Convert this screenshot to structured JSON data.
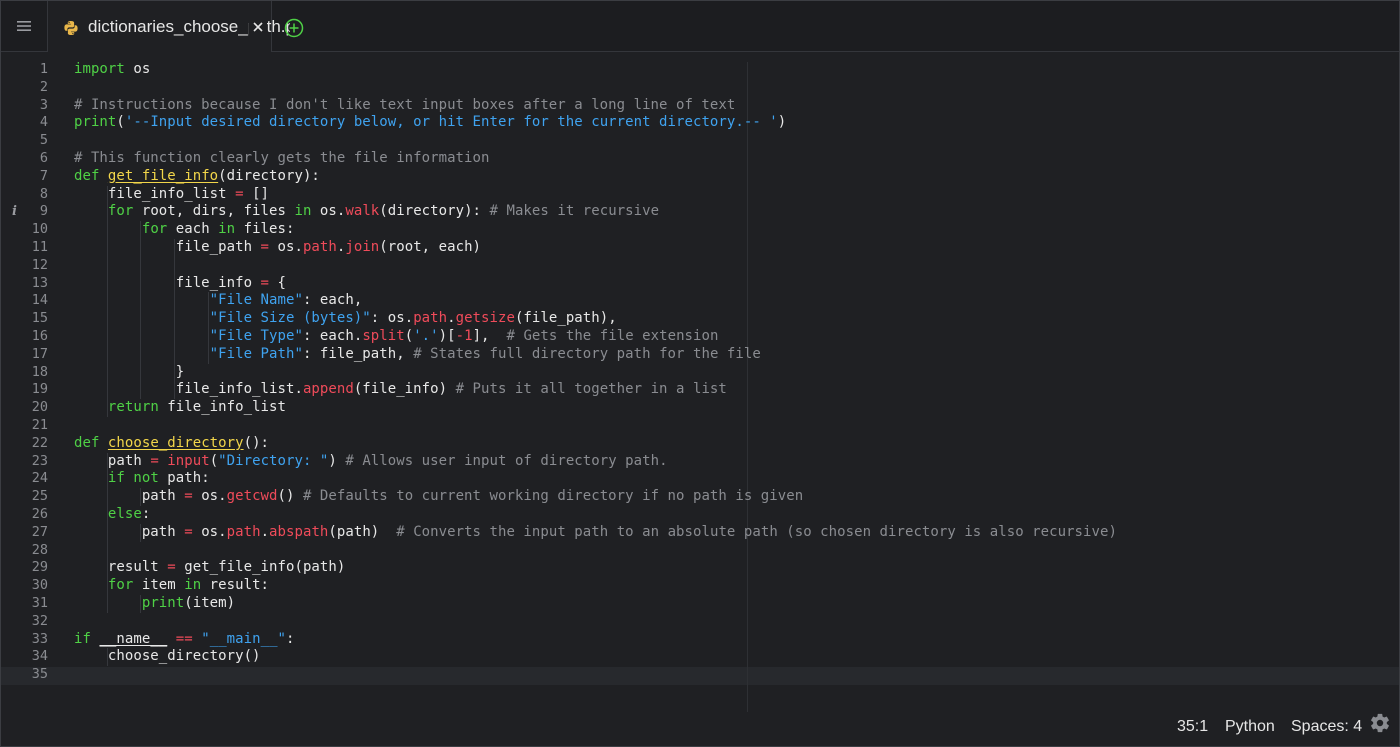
{
  "tab": {
    "title": "dictionaries_choose_path.py",
    "icon": "python-icon",
    "close_glyph": "×"
  },
  "editor": {
    "lines": [
      [
        [
          "kw",
          "import"
        ],
        [
          "t",
          " os"
        ]
      ],
      [],
      [
        [
          "cm",
          "# Instructions because I don't like text input boxes after a long line of text"
        ]
      ],
      [
        [
          "kw",
          "print"
        ],
        [
          "t",
          "("
        ],
        [
          "str",
          "'--Input desired directory below, or hit Enter for the current directory.-- '"
        ],
        [
          "t",
          ")"
        ]
      ],
      [],
      [
        [
          "cm",
          "# This function clearly gets the file information"
        ]
      ],
      [
        [
          "kw",
          "def"
        ],
        [
          "t",
          " "
        ],
        [
          "fn",
          "get_file_info"
        ],
        [
          "t",
          "(directory):"
        ]
      ],
      [
        [
          "t",
          "    file_info_list "
        ],
        [
          "op",
          "="
        ],
        [
          "t",
          " []"
        ]
      ],
      [
        [
          "t",
          "    "
        ],
        [
          "kw",
          "for"
        ],
        [
          "t",
          " root, dirs, files "
        ],
        [
          "kw",
          "in"
        ],
        [
          "t",
          " os."
        ],
        [
          "call",
          "walk"
        ],
        [
          "t",
          "(directory): "
        ],
        [
          "cm",
          "# Makes it recursive"
        ]
      ],
      [
        [
          "t",
          "        "
        ],
        [
          "kw",
          "for"
        ],
        [
          "t",
          " each "
        ],
        [
          "kw",
          "in"
        ],
        [
          "t",
          " files:"
        ]
      ],
      [
        [
          "t",
          "            file_path "
        ],
        [
          "op",
          "="
        ],
        [
          "t",
          " os."
        ],
        [
          "call",
          "path"
        ],
        [
          "t",
          "."
        ],
        [
          "call",
          "join"
        ],
        [
          "t",
          "(root, each)"
        ]
      ],
      [],
      [
        [
          "t",
          "            file_info "
        ],
        [
          "op",
          "="
        ],
        [
          "t",
          " {"
        ]
      ],
      [
        [
          "t",
          "                "
        ],
        [
          "str",
          "\"File Name\""
        ],
        [
          "t",
          ": each,"
        ]
      ],
      [
        [
          "t",
          "                "
        ],
        [
          "str",
          "\"File Size (bytes)\""
        ],
        [
          "t",
          ": os."
        ],
        [
          "call",
          "path"
        ],
        [
          "t",
          "."
        ],
        [
          "call",
          "getsize"
        ],
        [
          "t",
          "(file_path),"
        ]
      ],
      [
        [
          "t",
          "                "
        ],
        [
          "str",
          "\"File Type\""
        ],
        [
          "t",
          ": each."
        ],
        [
          "call",
          "split"
        ],
        [
          "t",
          "("
        ],
        [
          "str",
          "'.'"
        ],
        [
          "t",
          ")["
        ],
        [
          "num",
          "-1"
        ],
        [
          "t",
          "],  "
        ],
        [
          "cm",
          "# Gets the file extension"
        ]
      ],
      [
        [
          "t",
          "                "
        ],
        [
          "str",
          "\"File Path\""
        ],
        [
          "t",
          ": file_path, "
        ],
        [
          "cm",
          "# States full directory path for the file"
        ]
      ],
      [
        [
          "t",
          "            }"
        ]
      ],
      [
        [
          "t",
          "            file_info_list."
        ],
        [
          "call",
          "append"
        ],
        [
          "t",
          "(file_info) "
        ],
        [
          "cm",
          "# Puts it all together in a list"
        ]
      ],
      [
        [
          "t",
          "    "
        ],
        [
          "kw",
          "return"
        ],
        [
          "t",
          " file_info_list"
        ]
      ],
      [],
      [
        [
          "kw",
          "def"
        ],
        [
          "t",
          " "
        ],
        [
          "fn",
          "choose_directory"
        ],
        [
          "t",
          "():"
        ]
      ],
      [
        [
          "t",
          "    path "
        ],
        [
          "op",
          "="
        ],
        [
          "t",
          " "
        ],
        [
          "call",
          "input"
        ],
        [
          "t",
          "("
        ],
        [
          "str",
          "\"Directory: \""
        ],
        [
          "t",
          ") "
        ],
        [
          "cm",
          "# Allows user input of directory path."
        ]
      ],
      [
        [
          "t",
          "    "
        ],
        [
          "kw",
          "if"
        ],
        [
          "t",
          " "
        ],
        [
          "kw",
          "not"
        ],
        [
          "t",
          " path:"
        ]
      ],
      [
        [
          "t",
          "        path "
        ],
        [
          "op",
          "="
        ],
        [
          "t",
          " os."
        ],
        [
          "call",
          "getcwd"
        ],
        [
          "t",
          "() "
        ],
        [
          "cm",
          "# Defaults to current working directory if no path is given"
        ]
      ],
      [
        [
          "t",
          "    "
        ],
        [
          "kw",
          "else"
        ],
        [
          "t",
          ":"
        ]
      ],
      [
        [
          "t",
          "        path "
        ],
        [
          "op",
          "="
        ],
        [
          "t",
          " os."
        ],
        [
          "call",
          "path"
        ],
        [
          "t",
          "."
        ],
        [
          "call",
          "abspath"
        ],
        [
          "t",
          "(path)  "
        ],
        [
          "cm",
          "# Converts the input path to an absolute path (so chosen directory is also recursive)"
        ]
      ],
      [],
      [
        [
          "t",
          "    result "
        ],
        [
          "op",
          "="
        ],
        [
          "t",
          " get_file_info(path)"
        ]
      ],
      [
        [
          "t",
          "    "
        ],
        [
          "kw",
          "for"
        ],
        [
          "t",
          " item "
        ],
        [
          "kw",
          "in"
        ],
        [
          "t",
          " result:"
        ]
      ],
      [
        [
          "t",
          "        "
        ],
        [
          "kw",
          "print"
        ],
        [
          "t",
          "(item)"
        ]
      ],
      [],
      [
        [
          "kw",
          "if"
        ],
        [
          "t",
          " "
        ],
        [
          "dunder",
          "__name__"
        ],
        [
          "t",
          " "
        ],
        [
          "op",
          "=="
        ],
        [
          "t",
          " "
        ],
        [
          "str",
          "\"__main__\""
        ],
        [
          "t",
          ":"
        ]
      ],
      [
        [
          "t",
          "    choose_directory()"
        ]
      ],
      []
    ],
    "info_marker_line": 9,
    "info_marker_glyph": "i"
  },
  "status": {
    "cursor": "35:1",
    "language": "Python",
    "indent": "Spaces: 4"
  },
  "colors": {
    "keyword": "#4fd146",
    "function": "#f2d64a",
    "string": "#3fa3f0",
    "comment": "#8a8c91",
    "call": "#ef4b5a",
    "background": "#1f2023"
  }
}
